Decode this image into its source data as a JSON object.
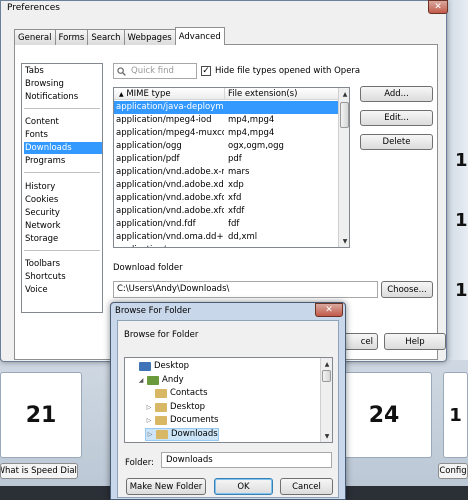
{
  "window": {
    "title": "Preferences",
    "close_glyph": "✕"
  },
  "tabs": [
    "General",
    "Forms",
    "Search",
    "Webpages",
    "Advanced"
  ],
  "categories": [
    [
      "Tabs",
      "Browsing",
      "Notifications"
    ],
    [
      "Content",
      "Fonts",
      "Downloads",
      "Programs"
    ],
    [
      "History",
      "Cookies",
      "Security",
      "Network",
      "Storage"
    ],
    [
      "Toolbars",
      "Shortcuts",
      "Voice"
    ]
  ],
  "selected_category": "Downloads",
  "search": {
    "placeholder": "Quick find"
  },
  "hide_checkbox": {
    "label": "Hide file types opened with Opera",
    "checked_glyph": "✓"
  },
  "mime_table": {
    "headers": [
      "MIME type",
      "File extension(s)"
    ],
    "sort_glyph": "▲",
    "rows": [
      [
        "application/java-deployme...",
        ""
      ],
      [
        "application/mpeg4-iod",
        "mp4,mpg4"
      ],
      [
        "application/mpeg4-muxco...",
        "mp4,mpg4"
      ],
      [
        "application/ogg",
        "ogx,ogm,ogg"
      ],
      [
        "application/pdf",
        "pdf"
      ],
      [
        "application/vnd.adobe.x-m...",
        "mars"
      ],
      [
        "application/vnd.adobe.xdp...",
        "xdp"
      ],
      [
        "application/vnd.adobe.xfd...",
        "xfd"
      ],
      [
        "application/vnd.adobe.xfdf",
        "xfdf"
      ],
      [
        "application/vnd.fdf",
        "fdf"
      ],
      [
        "application/vnd.oma.dd+xml",
        "dd,xml"
      ],
      [
        "application/...",
        ""
      ]
    ],
    "selected_row": 0
  },
  "buttons": {
    "add": "Add...",
    "edit": "Edit...",
    "delete": "Delete",
    "choose": "Choose...",
    "cancel": "cel",
    "help": "Help"
  },
  "download_folder": {
    "label": "Download folder",
    "value": "C:\\Users\\Andy\\Downloads\\"
  },
  "browse_dialog": {
    "title": "Browse For Folder",
    "description": "Browse for Folder",
    "tree": [
      {
        "label": "Desktop",
        "indent": 0,
        "expander": ""
      },
      {
        "label": "Andy",
        "indent": 1,
        "expander": "◢"
      },
      {
        "label": "Contacts",
        "indent": 2,
        "expander": ""
      },
      {
        "label": "Desktop",
        "indent": 2,
        "expander": "▷"
      },
      {
        "label": "Documents",
        "indent": 2,
        "expander": "▷"
      },
      {
        "label": "Downloads",
        "indent": 2,
        "expander": "▷"
      }
    ],
    "selected_tree_item": 5,
    "folder_label": "Folder:",
    "folder_value": "Downloads",
    "buttons": {
      "new_folder": "Make New Folder",
      "ok": "OK",
      "cancel": "Cancel"
    }
  },
  "speed_dial": {
    "tiles": [
      "21",
      "24"
    ],
    "edge_numbers": [
      "1",
      "1",
      "1",
      "1"
    ],
    "links": {
      "what_is": "What is Speed Dial?",
      "configure": "Config"
    }
  },
  "colors": {
    "selection": "#3399ff",
    "desktop": "#4a76aa"
  }
}
